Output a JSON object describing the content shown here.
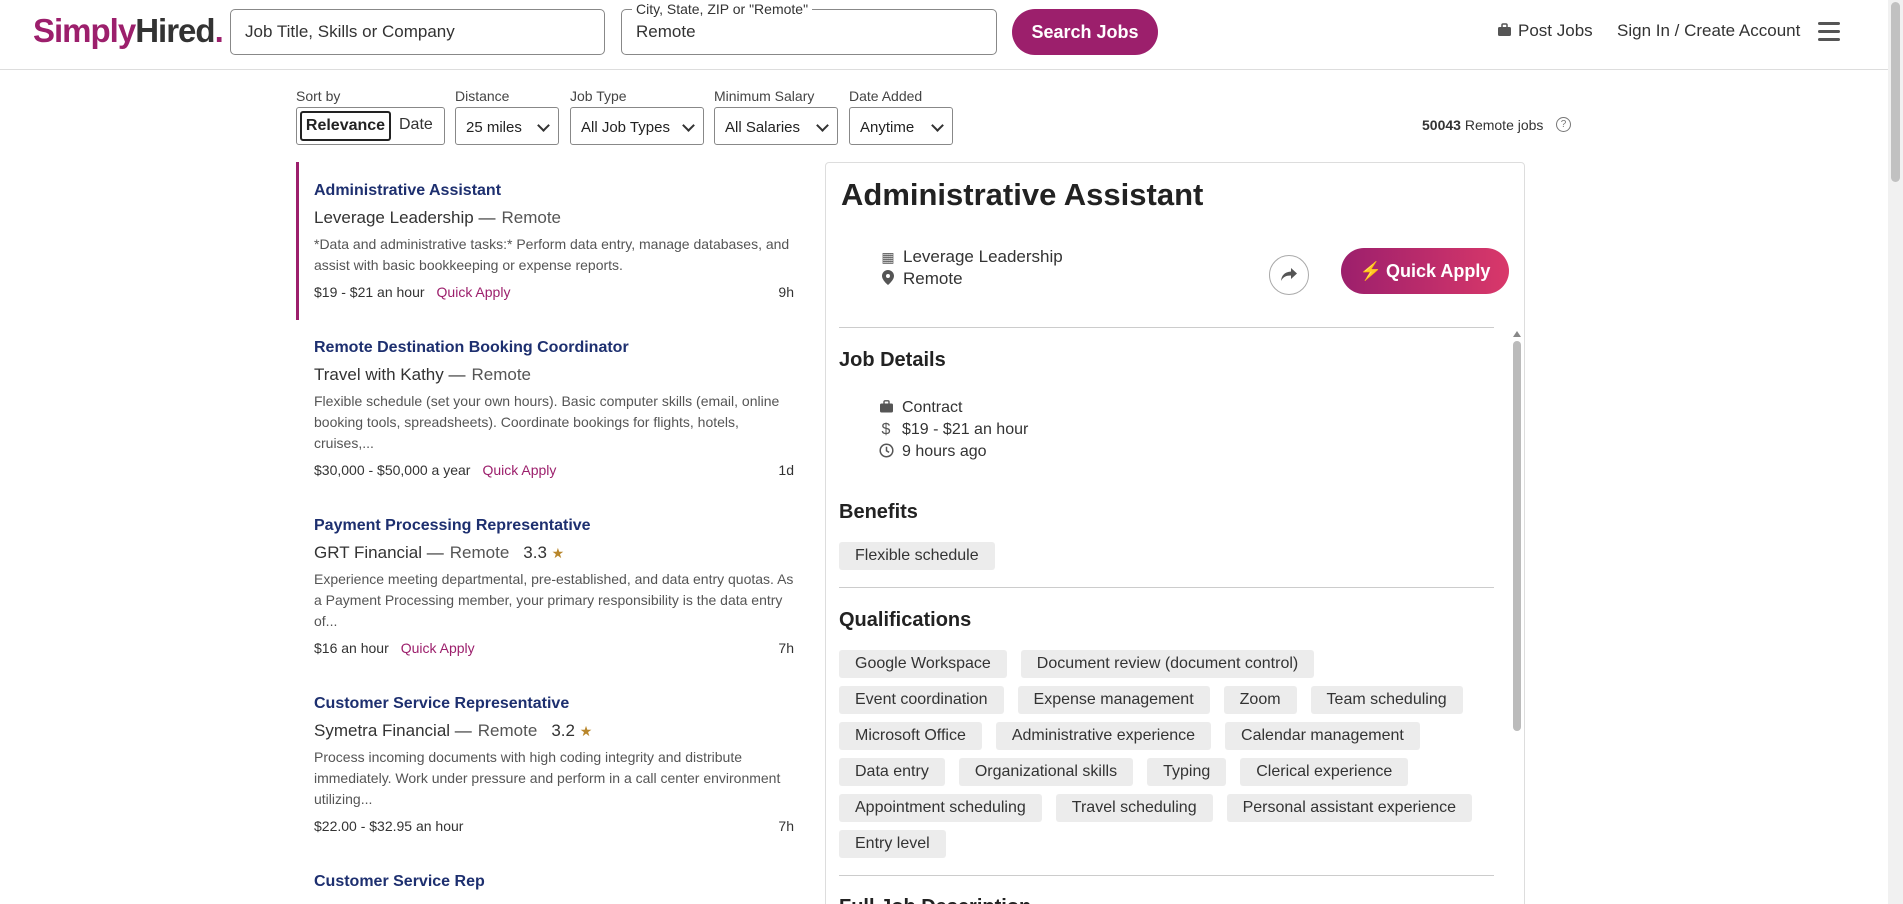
{
  "brand": {
    "simply": "Simply",
    "hired": "Hired",
    "dot": "."
  },
  "search": {
    "what_placeholder": "Job Title, Skills or Company",
    "where_label": "City, State, ZIP or \"Remote\"",
    "where_value": "Remote",
    "button": "Search Jobs"
  },
  "header_links": {
    "post_jobs": "Post Jobs",
    "sign_in": "Sign In / Create Account"
  },
  "filters": {
    "sort_label": "Sort by",
    "sort_relevance": "Relevance",
    "sort_date": "Date",
    "distance_label": "Distance",
    "distance_value": "25 miles",
    "jobtype_label": "Job Type",
    "jobtype_value": "All Job Types",
    "salary_label": "Minimum Salary",
    "salary_value": "All Salaries",
    "date_label": "Date Added",
    "date_value": "Anytime"
  },
  "results": {
    "count": "50043",
    "suffix": "Remote jobs",
    "help": "?"
  },
  "jobs": [
    {
      "title": "Administrative Assistant",
      "company": "Leverage Leadership —",
      "location": "Remote",
      "rating": "",
      "snippet": "*Data and administrative tasks:* Perform data entry, manage databases, and assist with basic bookkeeping or expense reports.",
      "salary": "$19 - $21 an hour",
      "quick_apply": "Quick Apply",
      "age": "9h"
    },
    {
      "title": "Remote Destination Booking Coordinator",
      "company": "Travel with Kathy —",
      "location": "Remote",
      "rating": "",
      "snippet": "Flexible schedule (set your own hours). Basic computer skills (email, online booking tools, spreadsheets). Coordinate bookings for flights, hotels, cruises,...",
      "salary": "$30,000 - $50,000 a year",
      "quick_apply": "Quick Apply",
      "age": "1d"
    },
    {
      "title": "Payment Processing Representative",
      "company": "GRT Financial —",
      "location": "Remote",
      "rating": "3.3",
      "snippet": "Experience meeting departmental, pre-established, and data entry quotas. As a Payment Processing member, your primary responsibility is the data entry of...",
      "salary": "$16 an hour",
      "quick_apply": "Quick Apply",
      "age": "7h"
    },
    {
      "title": "Customer Service Representative",
      "company": "Symetra Financial —",
      "location": "Remote",
      "rating": "3.2",
      "snippet": "Process incoming documents with high coding integrity and distribute immediately. Work under pressure and perform in a call center environment utilizing...",
      "salary": "$22.00 - $32.95 an hour",
      "quick_apply": "",
      "age": "7h"
    },
    {
      "title": "Customer Service Rep",
      "company": "",
      "location": "",
      "rating": "",
      "snippet": "",
      "salary": "",
      "quick_apply": "",
      "age": ""
    }
  ],
  "detail": {
    "title": "Administrative Assistant",
    "company": "Leverage Leadership",
    "location": "Remote",
    "quick_apply": "Quick Apply",
    "job_details_heading": "Job Details",
    "job_type": "Contract",
    "salary": "$19 - $21 an hour",
    "posted": "9 hours ago",
    "benefits_heading": "Benefits",
    "benefits": [
      "Flexible schedule"
    ],
    "qualifications_heading": "Qualifications",
    "qualifications": [
      "Google Workspace",
      "Document review (document control)",
      "Event coordination",
      "Expense management",
      "Zoom",
      "Team scheduling",
      "Microsoft Office",
      "Administrative experience",
      "Calendar management",
      "Data entry",
      "Organizational skills",
      "Typing",
      "Clerical experience",
      "Appointment scheduling",
      "Travel scheduling",
      "Personal assistant experience",
      "Entry level"
    ],
    "full_description_heading": "Full Job Description"
  },
  "colors": {
    "brand": "#9c1f6c",
    "title_link": "#1d2f6f"
  }
}
